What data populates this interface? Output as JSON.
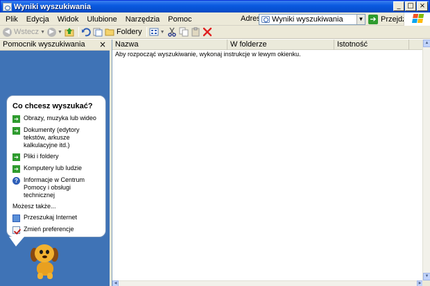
{
  "window": {
    "title": "Wyniki wyszukiwania"
  },
  "menu": [
    "Plik",
    "Edycja",
    "Widok",
    "Ulubione",
    "Narzędzia",
    "Pomoc"
  ],
  "address": {
    "label": "Adres",
    "value": "Wyniki wyszukiwania",
    "go_label": "Przejdź"
  },
  "toolbar": {
    "back_label": "Wstecz",
    "folders_label": "Foldery"
  },
  "search_pane": {
    "title": "Pomocnik wyszukiwania",
    "question": "Co chcesz wyszukać?",
    "options": [
      {
        "label": "Obrazy, muzyka lub wideo",
        "icon": "green-arrow-icon"
      },
      {
        "label": "Dokumenty (edytory tekstów, arkusze kalkulacyjne itd.)",
        "icon": "green-arrow-icon"
      },
      {
        "label": "Pliki i foldery",
        "icon": "green-arrow-icon"
      },
      {
        "label": "Komputery lub ludzie",
        "icon": "green-arrow-icon"
      },
      {
        "label": "Informacje w Centrum Pomocy i obsługi technicznej",
        "icon": "help-icon"
      }
    ],
    "see_also": "Możesz także...",
    "also_options": [
      {
        "label": "Przeszukaj Internet",
        "icon": "internet-search-icon"
      },
      {
        "label": "Zmień preferencje",
        "icon": "preferences-icon"
      }
    ]
  },
  "results": {
    "columns": [
      "Nazwa",
      "W folderze",
      "Istotność"
    ],
    "message": "Aby rozpocząć wyszukiwanie, wykonaj instrukcje w lewym okienku."
  },
  "colors": {
    "pane_bg": "#3f73b6",
    "title_bar": "#0a5ae0",
    "go_green": "#2e9b2e"
  }
}
